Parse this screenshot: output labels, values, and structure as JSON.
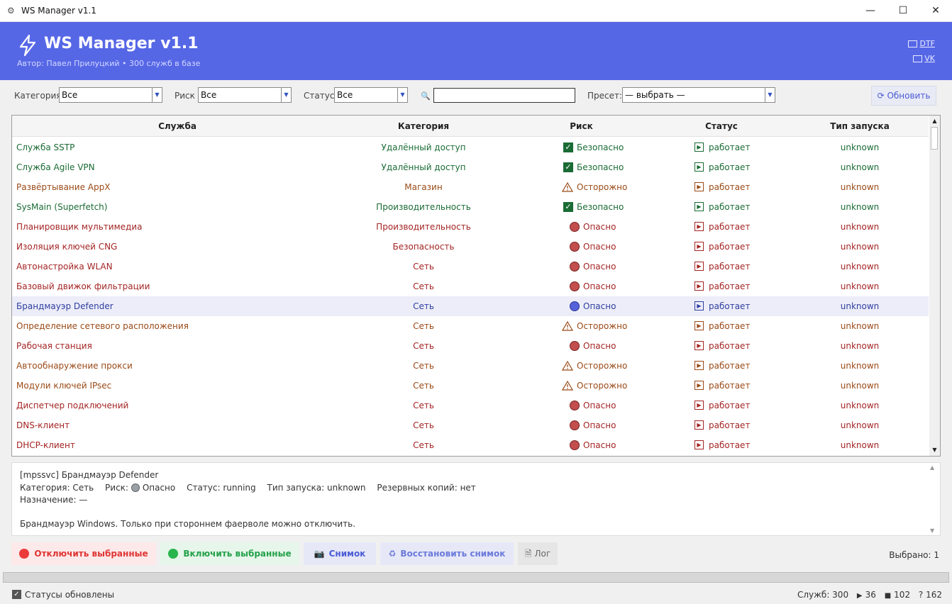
{
  "window": {
    "title": "WS Manager v1.1",
    "min": "—",
    "max": "☐",
    "close": "✕"
  },
  "header": {
    "title": "WS Manager v1.1",
    "subtitle": "Автор: Павел Прилуцкий  •  300 служб в базе",
    "links": {
      "dtf": "DTF",
      "vk": "VK"
    },
    "bg_color": "#5667e6"
  },
  "filters": {
    "category": {
      "label": "Категория",
      "value": "Все"
    },
    "risk": {
      "label": "Риск",
      "value": "Все"
    },
    "status": {
      "label": "Статус",
      "value": "Все"
    },
    "search": {
      "value": ""
    },
    "preset": {
      "label": "Пресет:",
      "value": "— выбрать —"
    },
    "refresh_label": "Обновить"
  },
  "table": {
    "columns": [
      "Служба",
      "Категория",
      "Риск",
      "Статус",
      "Тип запуска"
    ],
    "rows": [
      {
        "name": "Служба SSTP",
        "category": "Удалённый доступ",
        "risk": "Безопасно",
        "risk_level": "safe",
        "status": "работает",
        "start": "unknown",
        "color": "green"
      },
      {
        "name": "Служба Agile VPN",
        "category": "Удалённый доступ",
        "risk": "Безопасно",
        "risk_level": "safe",
        "status": "работает",
        "start": "unknown",
        "color": "green"
      },
      {
        "name": "Развёртывание AppX",
        "category": "Магазин",
        "risk": "Осторожно",
        "risk_level": "warn",
        "status": "работает",
        "start": "unknown",
        "color": "brown"
      },
      {
        "name": "SysMain (Superfetch)",
        "category": "Производительность",
        "risk": "Безопасно",
        "risk_level": "safe",
        "status": "работает",
        "start": "unknown",
        "color": "green"
      },
      {
        "name": "Планировщик мультимедиа",
        "category": "Производительность",
        "risk": "Опасно",
        "risk_level": "danger",
        "status": "работает",
        "start": "unknown",
        "color": "red"
      },
      {
        "name": "Изоляция ключей CNG",
        "category": "Безопасность",
        "risk": "Опасно",
        "risk_level": "danger",
        "status": "работает",
        "start": "unknown",
        "color": "red"
      },
      {
        "name": "Автонастройка WLAN",
        "category": "Сеть",
        "risk": "Опасно",
        "risk_level": "danger",
        "status": "работает",
        "start": "unknown",
        "color": "red"
      },
      {
        "name": "Базовый движок фильтрации",
        "category": "Сеть",
        "risk": "Опасно",
        "risk_level": "danger",
        "status": "работает",
        "start": "unknown",
        "color": "red"
      },
      {
        "name": "Брандмауэр Defender",
        "category": "Сеть",
        "risk": "Опасно",
        "risk_level": "danger",
        "status": "работает",
        "start": "unknown",
        "color": "blue",
        "selected": true
      },
      {
        "name": "Определение сетевого расположения",
        "category": "Сеть",
        "risk": "Осторожно",
        "risk_level": "warn",
        "status": "работает",
        "start": "unknown",
        "color": "brown"
      },
      {
        "name": "Рабочая станция",
        "category": "Сеть",
        "risk": "Опасно",
        "risk_level": "danger",
        "status": "работает",
        "start": "unknown",
        "color": "red"
      },
      {
        "name": "Автообнаружение прокси",
        "category": "Сеть",
        "risk": "Осторожно",
        "risk_level": "warn",
        "status": "работает",
        "start": "unknown",
        "color": "brown"
      },
      {
        "name": "Модули ключей IPsec",
        "category": "Сеть",
        "risk": "Осторожно",
        "risk_level": "warn",
        "status": "работает",
        "start": "unknown",
        "color": "brown"
      },
      {
        "name": "Диспетчер подключений",
        "category": "Сеть",
        "risk": "Опасно",
        "risk_level": "danger",
        "status": "работает",
        "start": "unknown",
        "color": "red"
      },
      {
        "name": "DNS-клиент",
        "category": "Сеть",
        "risk": "Опасно",
        "risk_level": "danger",
        "status": "работает",
        "start": "unknown",
        "color": "red"
      },
      {
        "name": "DHCP-клиент",
        "category": "Сеть",
        "risk": "Опасно",
        "risk_level": "danger",
        "status": "работает",
        "start": "unknown",
        "color": "red"
      }
    ]
  },
  "details": {
    "line1": "[mpssvc]  Брандмауэр Defender",
    "category": "Категория: Сеть",
    "risk_label": "Риск:",
    "risk_value": "Опасно",
    "status": "Статус: running",
    "start_type": "Тип запуска: unknown",
    "backups": "Резервных копий: нет",
    "purpose": "Назначение: —",
    "description": "Брандмауэр Windows. Только при стороннем фаерволе можно отключить."
  },
  "actions": {
    "disable": "Отключить выбранные",
    "enable": "Включить выбранные",
    "snapshot": "Снимок",
    "restore": "Восстановить снимок",
    "log": "Лог",
    "selected": "Выбрано: 1"
  },
  "statusbar": {
    "message": "Статусы обновлены",
    "services": "Служб: 300",
    "running": "36",
    "stopped": "102",
    "unknown": "? 162"
  },
  "colors": {
    "green": "#1a6b35",
    "red": "#a42424",
    "brown": "#9a4a17",
    "blue": "#2f3ea0"
  }
}
